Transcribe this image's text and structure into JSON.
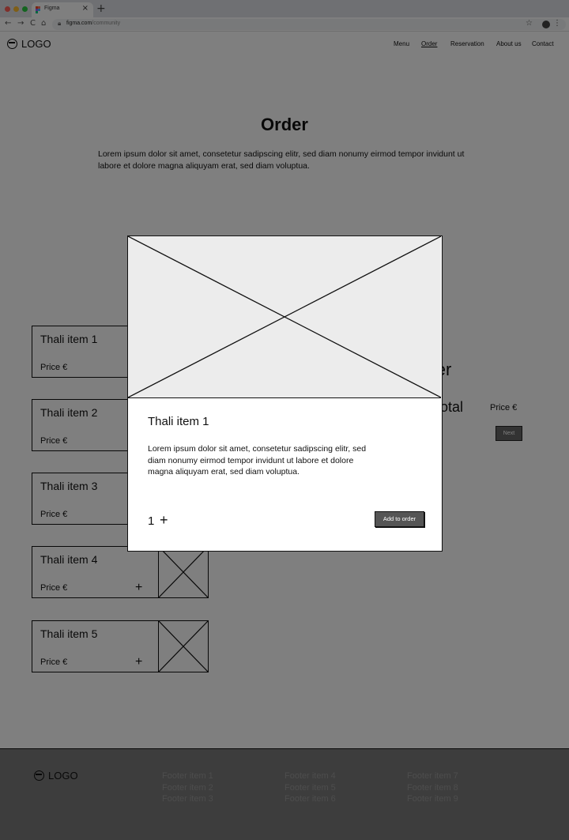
{
  "browser": {
    "tab_title": "Figma",
    "tab_close": "×",
    "new_tab": "+",
    "url_host": "figma.com",
    "url_path": "/community",
    "controls": {
      "back": "←",
      "forward": "→",
      "reload": "C",
      "home": "⌂",
      "star": "☆",
      "menu": "⋮"
    }
  },
  "header": {
    "logo": "LOGO",
    "nav": [
      "Menu",
      "Order",
      "Reservation",
      "About us",
      "Contact"
    ],
    "active_nav": "Order"
  },
  "main": {
    "title": "Order",
    "intro": "Lorem ipsum dolor sit amet, consetetur sadipscing elitr, sed diam nonumy eirmod tempor invidunt ut labore et dolore magna aliquyam erat, sed diam voluptua."
  },
  "items": [
    {
      "name": "Thali item 1",
      "price": "Price €",
      "add": "+"
    },
    {
      "name": "Thali item 2",
      "price": "Price €",
      "add": "+"
    },
    {
      "name": "Thali item 3",
      "price": "Price €",
      "add": "+"
    },
    {
      "name": "Thali item 4",
      "price": "Price €",
      "add": "+"
    },
    {
      "name": "Thali item 5",
      "price": "Price €",
      "add": "+"
    }
  ],
  "summary": {
    "heading": "order",
    "total_label": "Total",
    "total_price": "Price €",
    "next_label": "Next"
  },
  "modal": {
    "title": "Thali item 1",
    "description": "Lorem ipsum dolor sit amet, consetetur sadipscing elitr, sed diam nonumy eirmod tempor invidunt ut labore et dolore magna aliquyam erat, sed diam voluptua.",
    "quantity": "1",
    "plus": "+",
    "add_label": "Add to order"
  },
  "footer": {
    "logo": "LOGO",
    "columns": [
      [
        "Footer item 1",
        "Footer item 2",
        "Footer item 3"
      ],
      [
        "Footer item 4",
        "Footer item 5",
        "Footer item 6"
      ],
      [
        "Footer item 7",
        "Footer item 8",
        "Footer item 9"
      ]
    ]
  },
  "colors": {
    "overlay": "#000000",
    "chrome": "#dee1e6",
    "button": "#555555"
  }
}
